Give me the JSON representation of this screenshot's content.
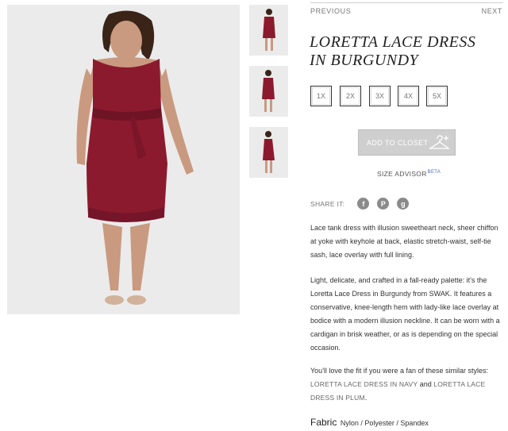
{
  "nav": {
    "previous": "PREVIOUS",
    "next": "NEXT"
  },
  "product": {
    "title_line1": "LORETTA LACE DRESS",
    "title_line2": "IN BURGUNDY"
  },
  "sizes": [
    "1X",
    "2X",
    "3X",
    "4X",
    "5X"
  ],
  "add_to_closet": "ADD TO CLOSET",
  "size_advisor": {
    "label": "SIZE ADVISOR",
    "badge": "BETA"
  },
  "share": {
    "label": "SHARE IT:",
    "icons": [
      "facebook-icon",
      "pinterest-icon",
      "google-plus-icon"
    ]
  },
  "description": {
    "p1": "Lace tank dress with illusion sweetheart neck, sheer chiffon at yoke with keyhole at back, elastic stretch-waist, self-tie sash, lace overlay with full lining.",
    "p2": "Light, delicate, and crafted in a fall-ready palette: it's the Loretta Lace Dress in Burgundy from SWAK. It features a conservative, knee-length hem with lady-like lace overlay at bodice with a modern illusion neckline. It can be worn with a cardigan in brisk weather, or as is depending on the special occasion.",
    "p3_before": "You'll love the fit if you were a fan of these similar styles: ",
    "link1": "LORETTA LACE DRESS IN NAVY",
    "p3_and": " and ",
    "link2": "LORETTA LACE DRESS IN PLUM",
    "p3_end": "."
  },
  "fabric": {
    "label": "Fabric",
    "value": "Nylon / Polyester / Spandex"
  },
  "colors": {
    "dress": "#8c1a2e",
    "background": "#ebebeb",
    "button": "#cfcfcf"
  }
}
